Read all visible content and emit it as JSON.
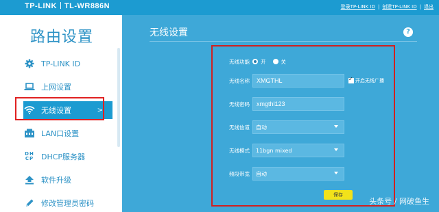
{
  "header": {
    "brand": "TP-LINK",
    "model": "TL-WR886N",
    "links": [
      "登录TP-LINK ID",
      "创建TP-LINK ID",
      "退出"
    ]
  },
  "sidebar": {
    "title": "路由设置",
    "items": [
      {
        "label": "TP-LINK ID",
        "icon": "gear-icon"
      },
      {
        "label": "上网设置",
        "icon": "laptop-icon"
      },
      {
        "label": "无线设置",
        "icon": "wifi-icon",
        "active": true,
        "arrow": ">"
      },
      {
        "label": "LAN口设置",
        "icon": "router-icon"
      },
      {
        "label": "DHCP服务器",
        "icon": "dhcp-icon"
      },
      {
        "label": "软件升级",
        "icon": "upload-icon"
      },
      {
        "label": "修改管理员密码",
        "icon": "pencil-icon"
      }
    ]
  },
  "main": {
    "title": "无线设置",
    "help": "?",
    "form": {
      "wireless_function": {
        "label": "无线功能",
        "options": [
          "开",
          "关"
        ],
        "selected": "开"
      },
      "ssid": {
        "label": "无线名称",
        "value": "XMGTHL"
      },
      "broadcast": {
        "label": "开启无线广播",
        "checked": true
      },
      "password": {
        "label": "无线密码",
        "value": "xmgthl123"
      },
      "channel": {
        "label": "无线信道",
        "value": "自动"
      },
      "mode": {
        "label": "无线模式",
        "value": "11bgn mixed"
      },
      "bandwidth": {
        "label": "频段带宽",
        "value": "自动"
      },
      "save_label": "保存"
    }
  },
  "watermark": "头条号 / 网破鱼生",
  "colors": {
    "brand_blue": "#1c9bd1",
    "panel_blue": "#3ea8d8",
    "highlight_red": "#e02020",
    "save_yellow": "#f2e21a"
  }
}
